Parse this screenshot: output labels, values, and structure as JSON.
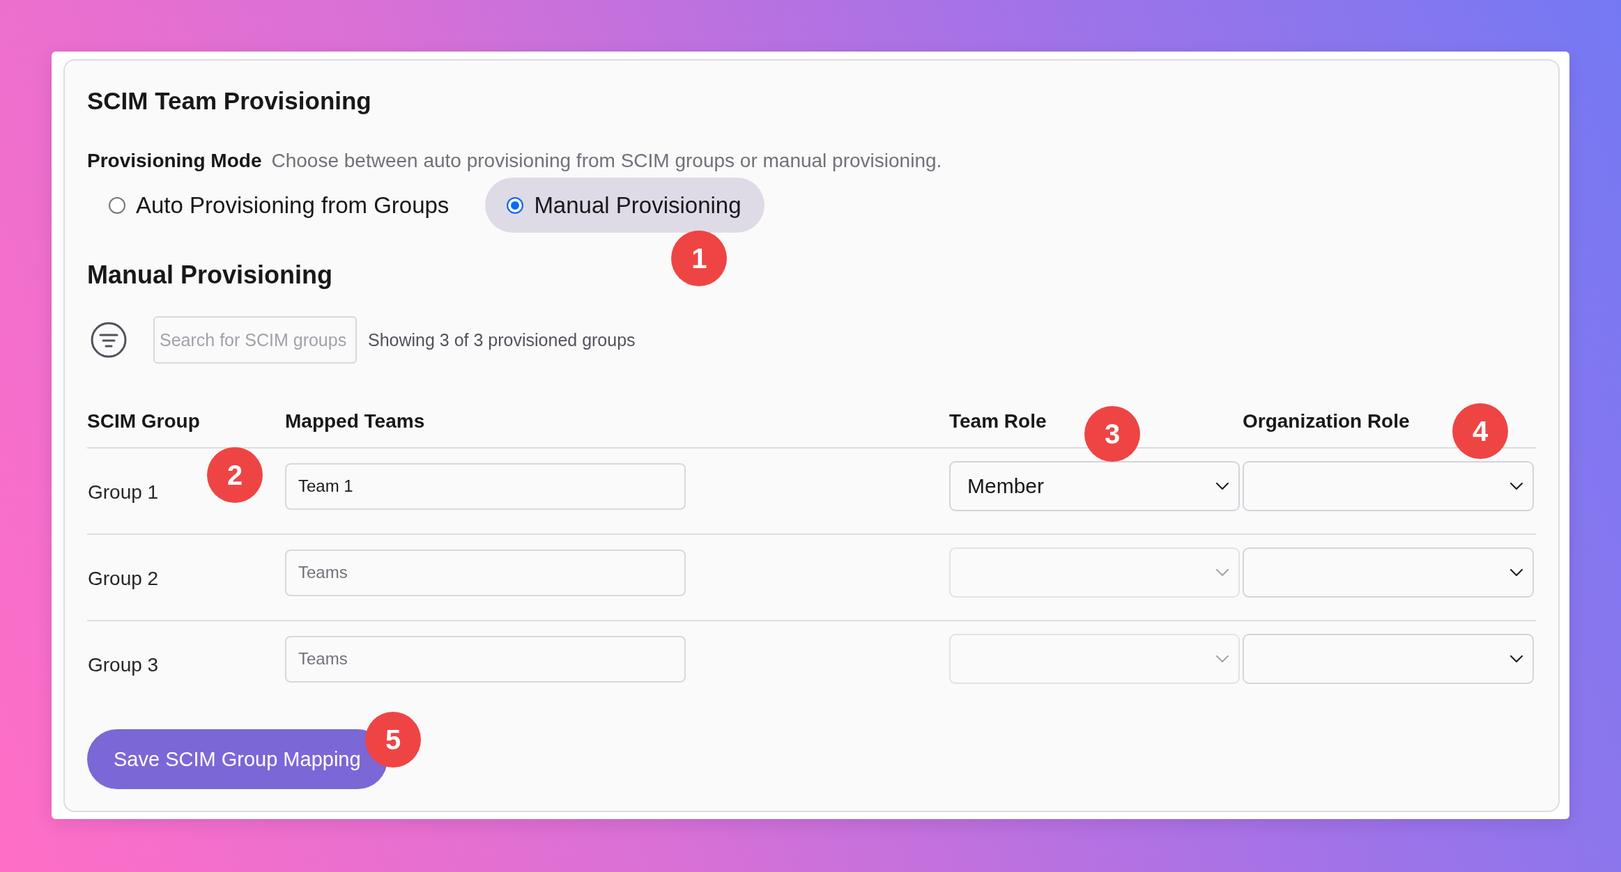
{
  "panel": {
    "title": "SCIM Team Provisioning"
  },
  "provisioning_mode": {
    "label": "Provisioning Mode",
    "description": "Choose between auto provisioning from SCIM groups or manual provisioning.",
    "options": [
      {
        "label": "Auto Provisioning from Groups",
        "selected": false
      },
      {
        "label": "Manual Provisioning",
        "selected": true,
        "callout": "1"
      }
    ]
  },
  "manual_section": {
    "heading": "Manual Provisioning",
    "search": {
      "placeholder": "Search for SCIM groups"
    },
    "summary": "Showing 3 of 3 provisioned groups"
  },
  "table": {
    "columns": [
      {
        "label": "SCIM Group"
      },
      {
        "label": "Mapped Teams"
      },
      {
        "label": "Team Role",
        "callout": "3"
      },
      {
        "label": "Organization Role",
        "callout": "4"
      }
    ],
    "rows": [
      {
        "group": "Group 1",
        "callout": "2",
        "teams": {
          "value": "Team 1"
        },
        "team_role": {
          "value": "Member",
          "disabled": false
        },
        "organization_role": {
          "disabled": false
        }
      },
      {
        "group": "Group 2",
        "teams": {
          "placeholder": "Teams"
        },
        "team_role": {
          "disabled": true
        },
        "organization_role": {
          "disabled": false
        }
      },
      {
        "group": "Group 3",
        "teams": {
          "placeholder": "Teams"
        },
        "team_role": {
          "disabled": true
        },
        "organization_role": {
          "disabled": false
        }
      }
    ]
  },
  "save_button": {
    "label": "Save SCIM Group Mapping",
    "callout": "5"
  }
}
